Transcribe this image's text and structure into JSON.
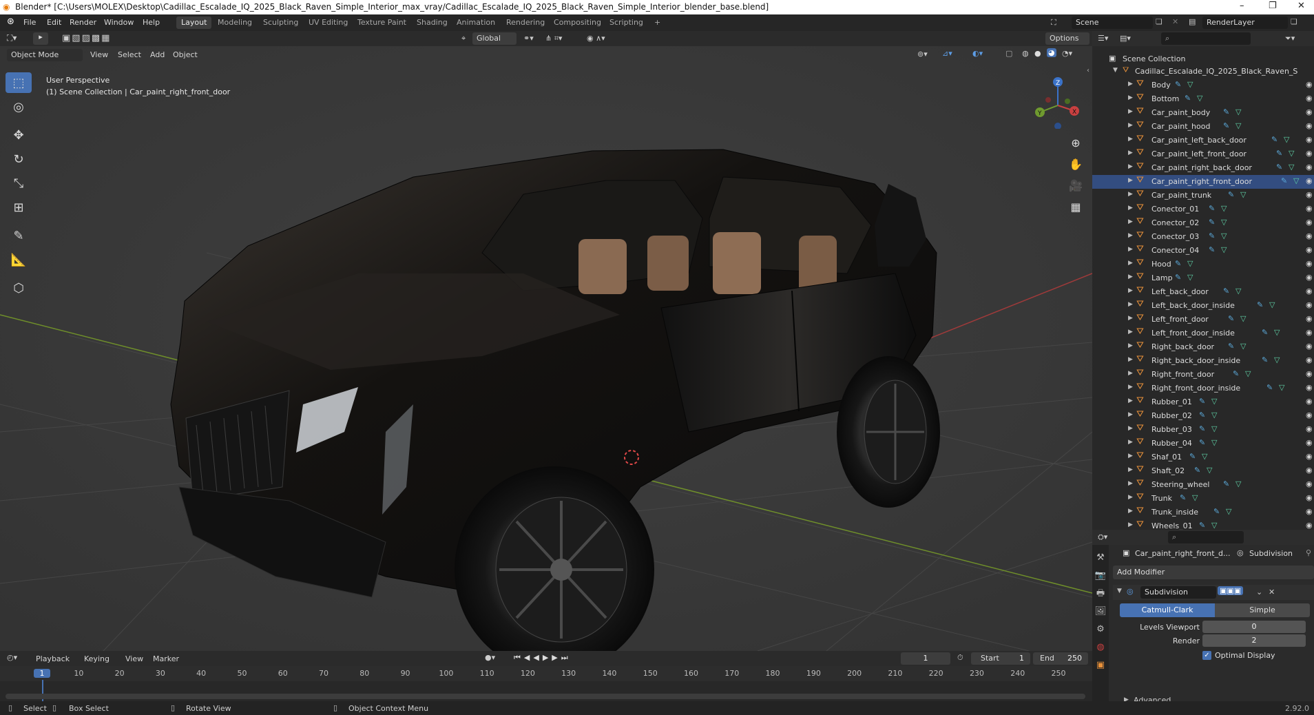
{
  "title_bar": {
    "title": "Blender* [C:\\Users\\MOLEX\\Desktop\\Cadillac_Escalade_IQ_2025_Black_Raven_Simple_Interior_max_vray/Cadillac_Escalade_IQ_2025_Black_Raven_Simple_Interior_blender_base.blend]",
    "minimize": "–",
    "maximize": "❐",
    "close": "✕"
  },
  "menus": [
    "File",
    "Edit",
    "Render",
    "Window",
    "Help"
  ],
  "workspaces": [
    "Layout",
    "Modeling",
    "Sculpting",
    "UV Editing",
    "Texture Paint",
    "Shading",
    "Animation",
    "Rendering",
    "Compositing",
    "Scripting",
    "+"
  ],
  "active_workspace": "Layout",
  "scene": {
    "label": "Scene",
    "render_layer": "RenderLayer"
  },
  "viewport_header": {
    "mode": "Object Mode",
    "menus": [
      "View",
      "Select",
      "Add",
      "Object"
    ],
    "transform_orientation": "Global",
    "options": "Options"
  },
  "viewport": {
    "perspective": "User Perspective",
    "collection_info": "(1) Scene Collection | Car_paint_right_front_door",
    "gizmo": {
      "z": "Z",
      "y": "Y",
      "x": "X"
    }
  },
  "outliner": {
    "root": "Scene Collection",
    "collection": "Cadillac_Escalade_IQ_2025_Black_Raven_S",
    "items": [
      "Body",
      "Bottom",
      "Car_paint_body",
      "Car_paint_hood",
      "Car_paint_left_back_door",
      "Car_paint_left_front_door",
      "Car_paint_right_back_door",
      "Car_paint_right_front_door",
      "Car_paint_trunk",
      "Conector_01",
      "Conector_02",
      "Conector_03",
      "Conector_04",
      "Hood",
      "Lamp",
      "Left_back_door",
      "Left_back_door_inside",
      "Left_front_door",
      "Left_front_door_inside",
      "Right_back_door",
      "Right_back_door_inside",
      "Right_front_door",
      "Right_front_door_inside",
      "Rubber_01",
      "Rubber_02",
      "Rubber_03",
      "Rubber_04",
      "Shaf_01",
      "Shaft_02",
      "Steering_wheel",
      "Trunk",
      "Trunk_inside",
      "Wheels_01"
    ],
    "selected": "Car_paint_right_front_door"
  },
  "properties": {
    "object": "Car_paint_right_front_d...",
    "modifier_tab": "Subdivision",
    "add_modifier": "Add Modifier",
    "modifier_name": "Subdivision",
    "type_options": [
      "Catmull-Clark",
      "Simple"
    ],
    "active_type": "Catmull-Clark",
    "levels_viewport_label": "Levels Viewport",
    "levels_viewport": "0",
    "render_label": "Render",
    "render": "2",
    "optimal_display": "Optimal Display",
    "advanced": "Advanced"
  },
  "timeline": {
    "menus": [
      "Playback",
      "Keying",
      "View",
      "Marker"
    ],
    "current_frame": "1",
    "start_label": "Start",
    "start": "1",
    "end_label": "End",
    "end": "250",
    "ticks": [
      "1",
      "10",
      "20",
      "30",
      "40",
      "50",
      "60",
      "70",
      "80",
      "90",
      "100",
      "110",
      "120",
      "130",
      "140",
      "150",
      "160",
      "170",
      "180",
      "190",
      "200",
      "210",
      "220",
      "230",
      "240",
      "250"
    ]
  },
  "status_bar": {
    "select": "Select",
    "box_select": "Box Select",
    "rotate_view": "Rotate View",
    "context_menu": "Object Context Menu",
    "version": "2.92.0"
  },
  "colors": {
    "accent": "#4772b3",
    "selected_row": "#334d80",
    "mesh_icon": "#e8913a"
  }
}
